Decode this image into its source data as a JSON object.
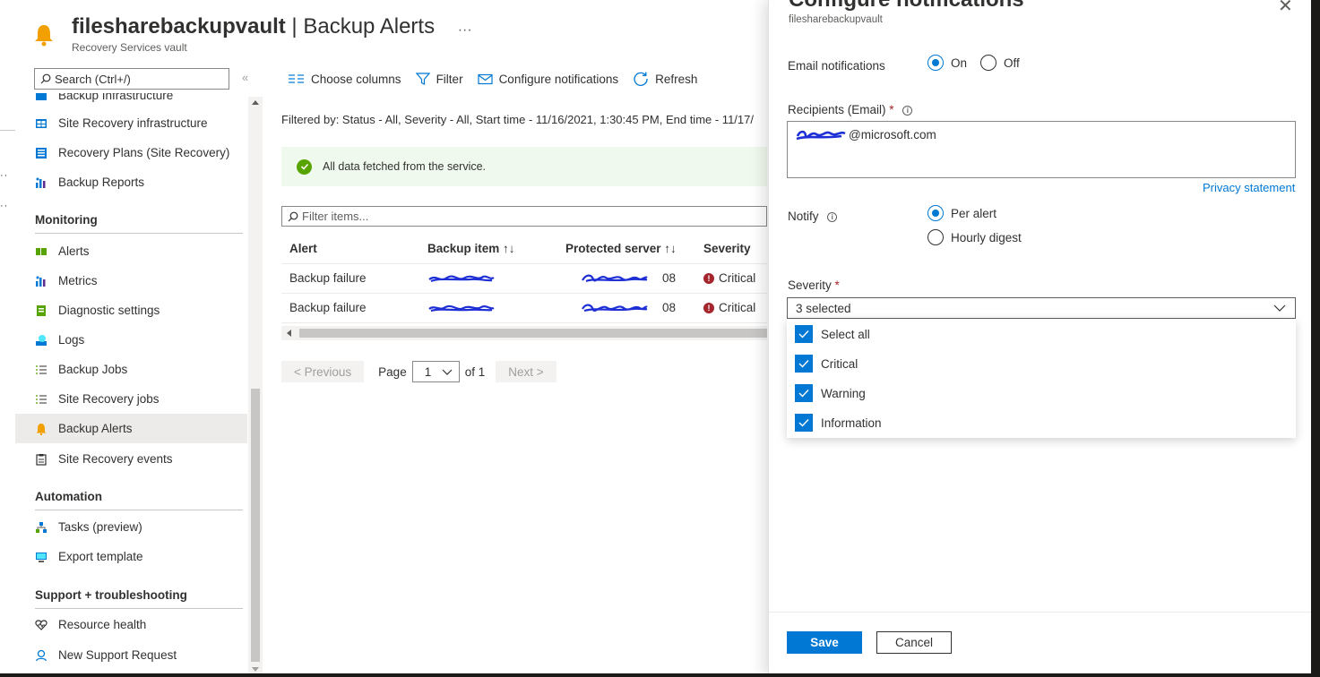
{
  "header": {
    "vault_name": "filesharebackupvault",
    "separator": " | ",
    "page_name": "Backup Alerts",
    "more": "···",
    "subtitle": "Recovery Services vault"
  },
  "sidebar": {
    "search_placeholder": "Search (Ctrl+/)",
    "collapse": "«",
    "items": [
      {
        "label": "Backup Infrastructure",
        "icon": "backup-infrastructure-icon"
      },
      {
        "label": "Site Recovery infrastructure",
        "icon": "site-recovery-infrastructure-icon"
      },
      {
        "label": "Recovery Plans (Site Recovery)",
        "icon": "recovery-plans-icon"
      },
      {
        "label": "Backup Reports",
        "icon": "reports-chart-icon"
      },
      {
        "label": "Alerts",
        "icon": "alerts-icon"
      },
      {
        "label": "Metrics",
        "icon": "metrics-chart-icon"
      },
      {
        "label": "Diagnostic settings",
        "icon": "diagnostic-settings-icon"
      },
      {
        "label": "Logs",
        "icon": "logs-icon"
      },
      {
        "label": "Backup Jobs",
        "icon": "backup-jobs-icon"
      },
      {
        "label": "Site Recovery jobs",
        "icon": "site-recovery-jobs-icon"
      },
      {
        "label": "Backup Alerts",
        "icon": "bell-icon"
      },
      {
        "label": "Site Recovery events",
        "icon": "events-clipboard-icon"
      },
      {
        "label": "Tasks (preview)",
        "icon": "tasks-icon"
      },
      {
        "label": "Export template",
        "icon": "export-template-icon"
      },
      {
        "label": "Resource health",
        "icon": "heart-pulse-icon"
      },
      {
        "label": "New Support Request",
        "icon": "support-person-icon"
      }
    ],
    "sections": {
      "monitoring": "Monitoring",
      "automation": "Automation",
      "support": "Support + troubleshooting"
    }
  },
  "toolbar": {
    "choose_columns": "Choose columns",
    "filter": "Filter",
    "configure_notifications": "Configure notifications",
    "refresh": "Refresh"
  },
  "main": {
    "filter_text": "Filtered by: Status - All, Severity - All, Start time - 11/16/2021, 1:30:45 PM, End time - 11/17/",
    "info_message": "All data fetched from the service.",
    "filter_placeholder": "Filter items...",
    "table": {
      "headers": [
        "Alert",
        "Backup item ↑↓",
        "Protected server ↑↓",
        "Severity"
      ],
      "rows": [
        {
          "alert": "Backup failure",
          "server_suffix": "08",
          "severity": "Critical"
        },
        {
          "alert": "Backup failure",
          "server_suffix": "08",
          "severity": "Critical"
        }
      ]
    },
    "pager": {
      "previous": "< Previous",
      "page_label": "Page",
      "page_value": "1",
      "of": "of 1",
      "next": "Next >"
    }
  },
  "panel": {
    "title": "Configure notifications",
    "subtitle": "filesharebackupvault",
    "close": "✕",
    "email_label": "Email notifications",
    "email_on": "On",
    "email_off": "Off",
    "recipients_label": "Recipients (Email)",
    "required_mark": "*",
    "recipients_value_suffix": "@microsoft.com",
    "privacy": "Privacy statement",
    "notify_label": "Notify",
    "notify_per_alert": "Per alert",
    "notify_hourly": "Hourly digest",
    "severity_label": "Severity",
    "severity_value": "3 selected",
    "options": [
      "Select all",
      "Critical",
      "Warning",
      "Information"
    ],
    "save": "Save",
    "cancel": "Cancel"
  },
  "colors": {
    "accent": "#0078d4",
    "critical": "#a4262c",
    "success": "#57a300",
    "warning_bell": "#f2a000"
  }
}
